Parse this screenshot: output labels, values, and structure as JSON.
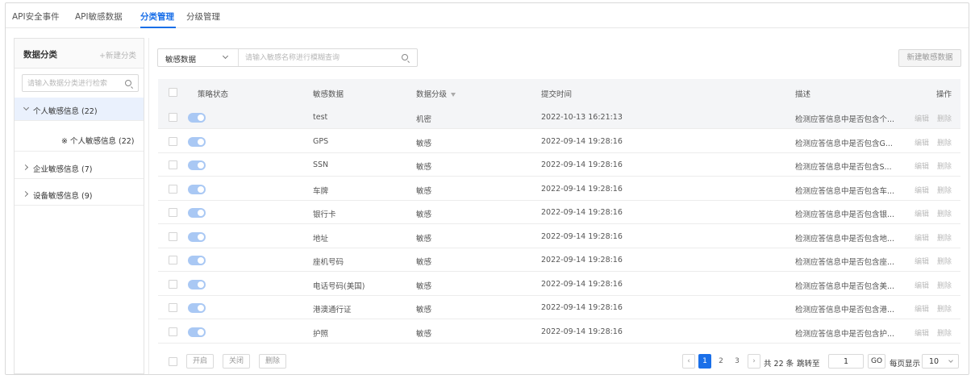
{
  "tabs": [
    {
      "label": "API安全事件"
    },
    {
      "label": "API敏感数据"
    },
    {
      "label": "分类管理",
      "active": true
    },
    {
      "label": "分级管理"
    }
  ],
  "sidebar": {
    "title": "数据分类",
    "new_label": "+新建分类",
    "search_placeholder": "请输入数据分类进行检索",
    "items": [
      {
        "label": "个人敏感信息  (22)",
        "expanded": true
      },
      {
        "label": "※ 个人敏感信息  (22)"
      },
      {
        "label": "企业敏感信息  (7)"
      },
      {
        "label": "设备敏感信息  (9)"
      }
    ]
  },
  "filter": {
    "select_value": "敏感数据",
    "search_placeholder": "请输入敏感名称进行模糊查询",
    "new_button": "新建敏感数据"
  },
  "table": {
    "columns": {
      "status": "策略状态",
      "data": "敏感数据",
      "level": "数据分级",
      "time": "提交时间",
      "desc": "描述",
      "ops": "操作"
    },
    "edit_label": "编辑",
    "delete_label": "删除",
    "rows": [
      {
        "data": "test",
        "level": "机密",
        "time": "2022-10-13 16:21:13",
        "desc": "检测应答信息中是否包含个..."
      },
      {
        "data": "GPS",
        "level": "敏感",
        "time": "2022-09-14 19:28:16",
        "desc": "检测应答信息中是否包含G..."
      },
      {
        "data": "SSN",
        "level": "敏感",
        "time": "2022-09-14 19:28:16",
        "desc": "检测应答信息中是否包含S..."
      },
      {
        "data": "车牌",
        "level": "敏感",
        "time": "2022-09-14 19:28:16",
        "desc": "检测应答信息中是否包含车..."
      },
      {
        "data": "银行卡",
        "level": "敏感",
        "time": "2022-09-14 19:28:16",
        "desc": "检测应答信息中是否包含银..."
      },
      {
        "data": "地址",
        "level": "敏感",
        "time": "2022-09-14 19:28:16",
        "desc": "检测应答信息中是否包含地..."
      },
      {
        "data": "座机号码",
        "level": "敏感",
        "time": "2022-09-14 19:28:16",
        "desc": "检测应答信息中是否包含座..."
      },
      {
        "data": "电话号码(美国)",
        "level": "敏感",
        "time": "2022-09-14 19:28:16",
        "desc": "检测应答信息中是否包含美..."
      },
      {
        "data": "港澳通行证",
        "level": "敏感",
        "time": "2022-09-14 19:28:16",
        "desc": "检测应答信息中是否包含港..."
      },
      {
        "data": "护照",
        "level": "敏感",
        "time": "2022-09-14 19:28:16",
        "desc": "检测应答信息中是否包含护..."
      }
    ]
  },
  "footer": {
    "open_label": "开启",
    "close_label": "关闭",
    "delete_label": "删除",
    "pages": [
      "1",
      "2",
      "3"
    ],
    "current_page": "1",
    "total_text": "共 22 条",
    "jump_label": "跳转至",
    "jump_value": "1",
    "go_label": "GO",
    "page_size_label": "每页显示",
    "page_size": "10"
  },
  "colors": {
    "accent": "#1a6fe8",
    "toggle": "#a9c8f4"
  }
}
